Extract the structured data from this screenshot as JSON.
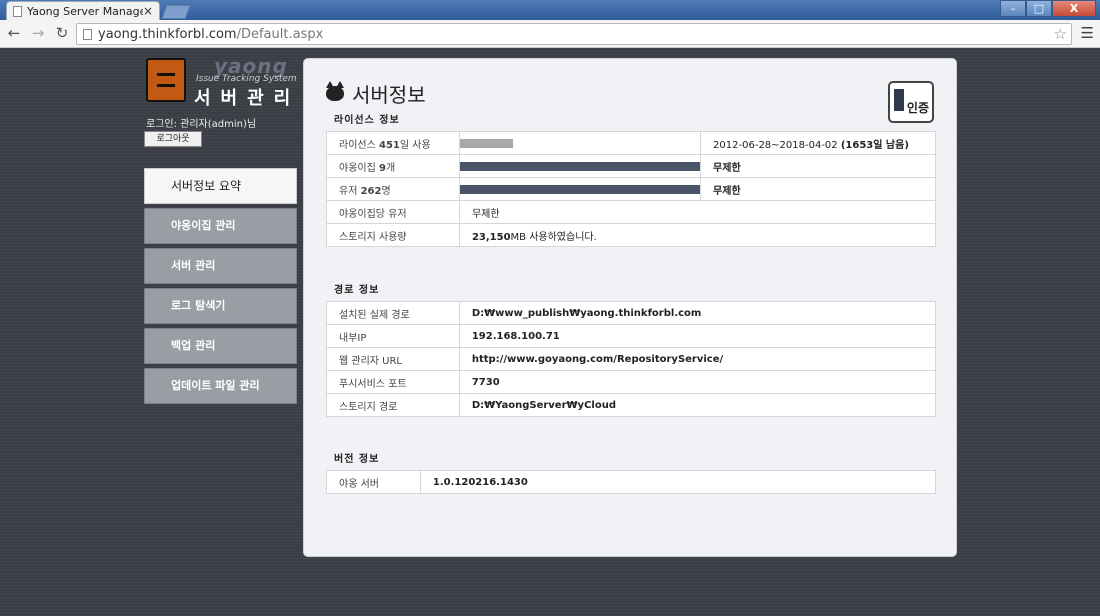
{
  "browser": {
    "tab_title": "Yaong Server Manager",
    "tab_close": "×",
    "url_host": "yaong.thinkforbl.com",
    "url_path": "/Default.aspx",
    "win_min": "–",
    "win_max": "□",
    "win_close": "X"
  },
  "sidebar": {
    "brand": "yaong",
    "tagline": "Issue Tracking System",
    "admin_title": "서버관리",
    "login_text": "로그인: 관리자(admin)님",
    "logout_label": "로그아웃",
    "menu": [
      {
        "label": "서버정보 요약",
        "active": true
      },
      {
        "label": "야옹이집 관리",
        "active": false
      },
      {
        "label": "서버 관리",
        "active": false
      },
      {
        "label": "로그 탐색기",
        "active": false
      },
      {
        "label": "백업 관리",
        "active": false
      },
      {
        "label": "업데이트 파일 관리",
        "active": false
      }
    ]
  },
  "panel": {
    "title": "서버정보",
    "cert_label": "인증"
  },
  "license": {
    "title": "라이선스 정보",
    "rows": [
      {
        "label_pre": "라이선스 ",
        "label_num": "451",
        "label_post": "일 사용",
        "usage_fraction": 0.22,
        "bar_style": "light",
        "value_pre": "2012-06-28~2018-04-02 ",
        "value_bold": "(1653일 남음)"
      },
      {
        "label_pre": "야옹이집 ",
        "label_num": "9",
        "label_post": "개",
        "usage_fraction": 1.0,
        "bar_style": "dark",
        "value_pre": "",
        "value_bold": "무제한"
      },
      {
        "label_pre": "유저 ",
        "label_num": "262",
        "label_post": "명",
        "usage_fraction": 1.0,
        "bar_style": "dark",
        "value_pre": "",
        "value_bold": "무제한"
      }
    ],
    "per_house_label": "야옹이집당 유저",
    "per_house_value": "무제한",
    "storage_label": "스토리지 사용량",
    "storage_num": "23,150",
    "storage_text": "MB 사용하였습니다."
  },
  "path_info": {
    "title": "경로 정보",
    "rows": [
      {
        "label": "설치된 실제 경로",
        "value": "D:₩www_publish₩yaong.thinkforbl.com"
      },
      {
        "label": "내부IP",
        "value": "192.168.100.71"
      },
      {
        "label": "웹 관리자 URL",
        "value": "http://www.goyaong.com/RepositoryService/"
      },
      {
        "label": "푸시서비스 포트",
        "value": "7730"
      },
      {
        "label": "스토리지 경로",
        "value": "D:₩YaongServer₩yCloud"
      }
    ]
  },
  "version": {
    "title": "버전 정보",
    "label": "야옹 서버",
    "value": "1.0.120216.1430"
  }
}
